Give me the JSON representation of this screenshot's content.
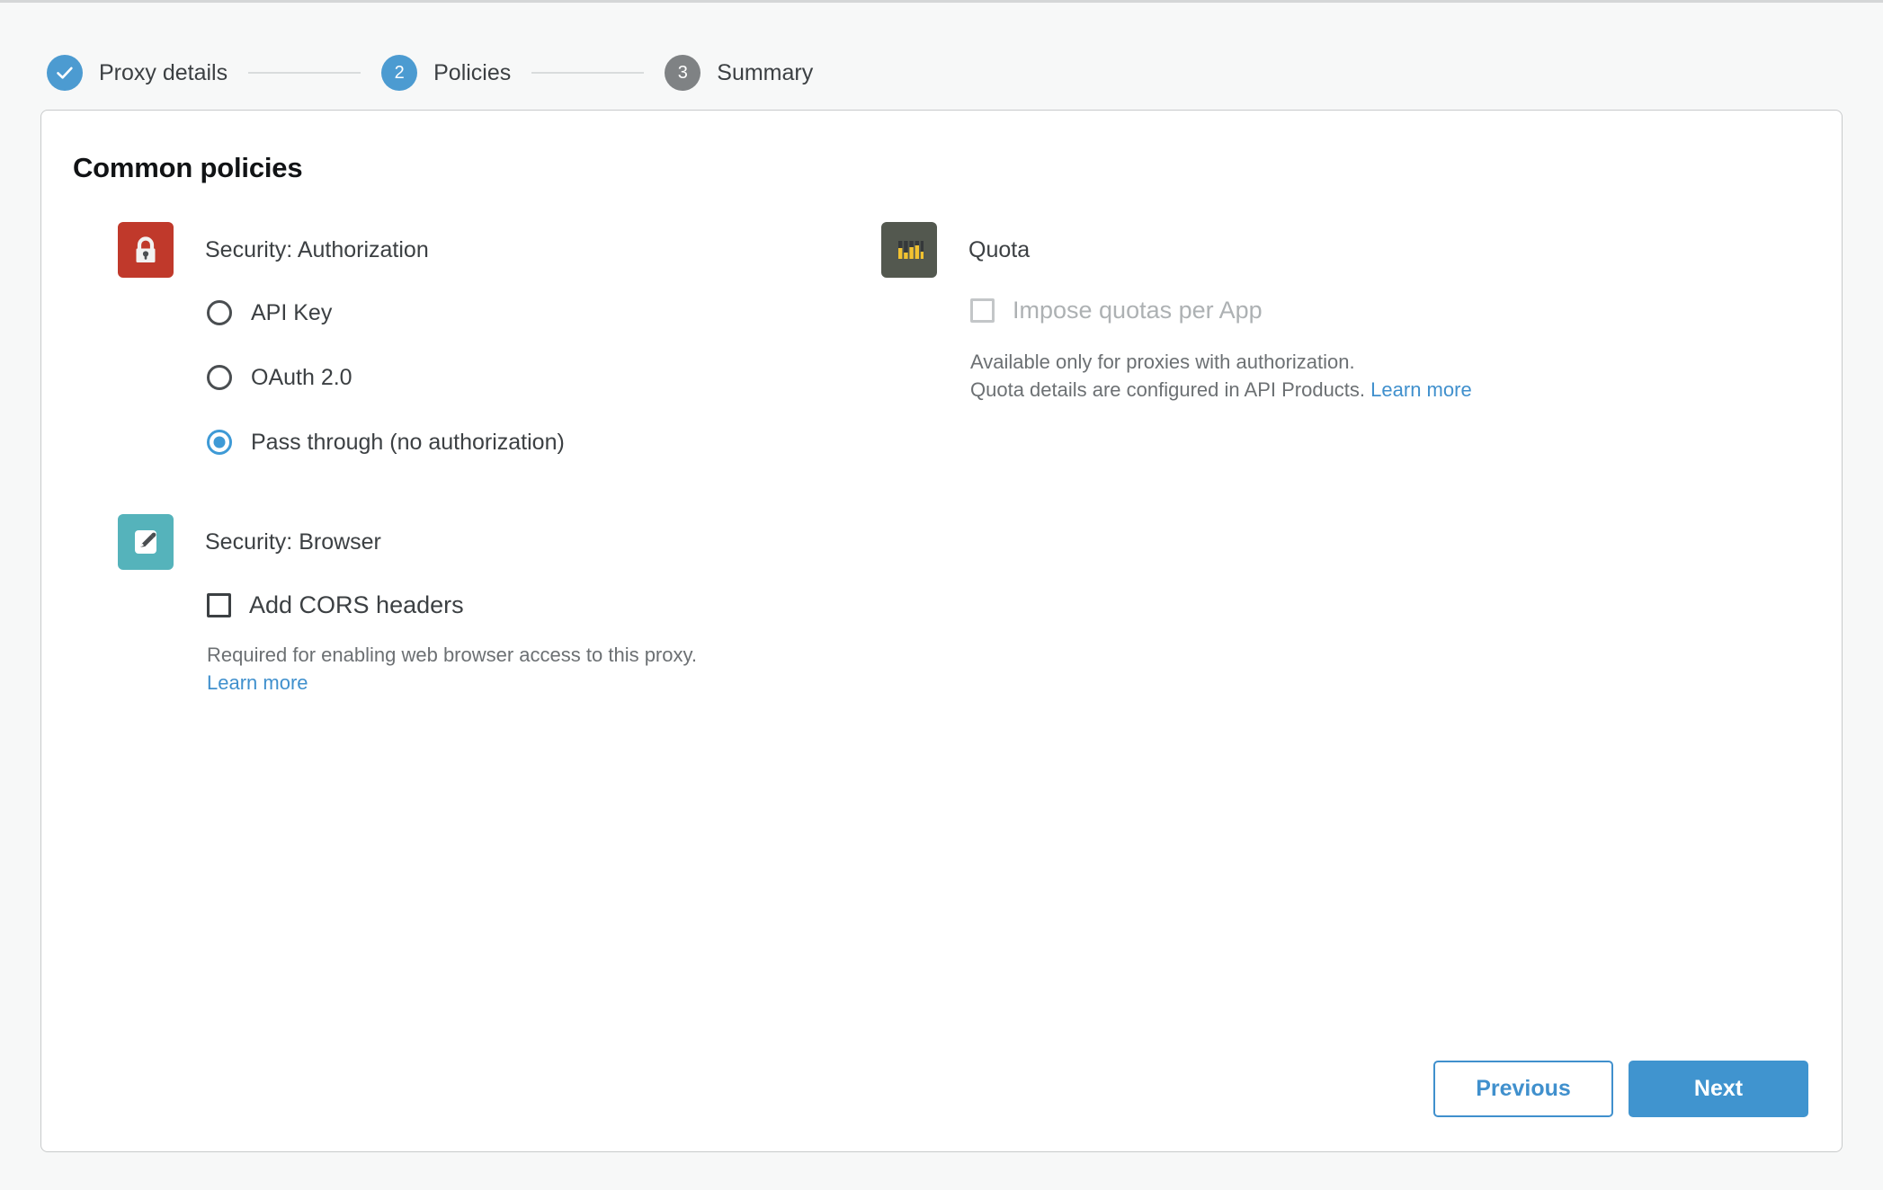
{
  "stepper": {
    "steps": [
      {
        "badge": "check-icon",
        "number": "",
        "label": "Proxy details",
        "state": "done"
      },
      {
        "badge": "",
        "number": "2",
        "label": "Policies",
        "state": "active"
      },
      {
        "badge": "",
        "number": "3",
        "label": "Summary",
        "state": "idle"
      }
    ]
  },
  "card": {
    "title": "Common policies",
    "policies": {
      "authorization": {
        "icon": "lock-icon",
        "name": "Security: Authorization",
        "options": [
          {
            "label": "API Key",
            "selected": false
          },
          {
            "label": "OAuth 2.0",
            "selected": false
          },
          {
            "label": "Pass through (no authorization)",
            "selected": true
          }
        ]
      },
      "browser": {
        "icon": "pencil-icon",
        "name": "Security: Browser",
        "checkbox": {
          "label": "Add CORS headers",
          "checked": false,
          "disabled": false
        },
        "help_line1": "Required for enabling web browser access to this proxy.",
        "help_link": "Learn more"
      },
      "quota": {
        "icon": "bar-chart-icon",
        "name": "Quota",
        "checkbox": {
          "label": "Impose quotas per App",
          "checked": false,
          "disabled": true
        },
        "help_line1": "Available only for proxies with authorization.",
        "help_line2": "Quota details are configured in API Products.",
        "help_link": "Learn more"
      }
    }
  },
  "footer": {
    "previous_label": "Previous",
    "next_label": "Next"
  },
  "colors": {
    "accent_blue": "#4094cf",
    "step_done": "#4c9bd1",
    "step_idle": "#7f8284",
    "lock_tile": "#c0392b",
    "pencil_tile": "#55b3bb",
    "quota_tile": "#53584f",
    "quota_bars": "#f2c230",
    "link": "#4090cd",
    "page_bg": "#f7f8f8"
  }
}
